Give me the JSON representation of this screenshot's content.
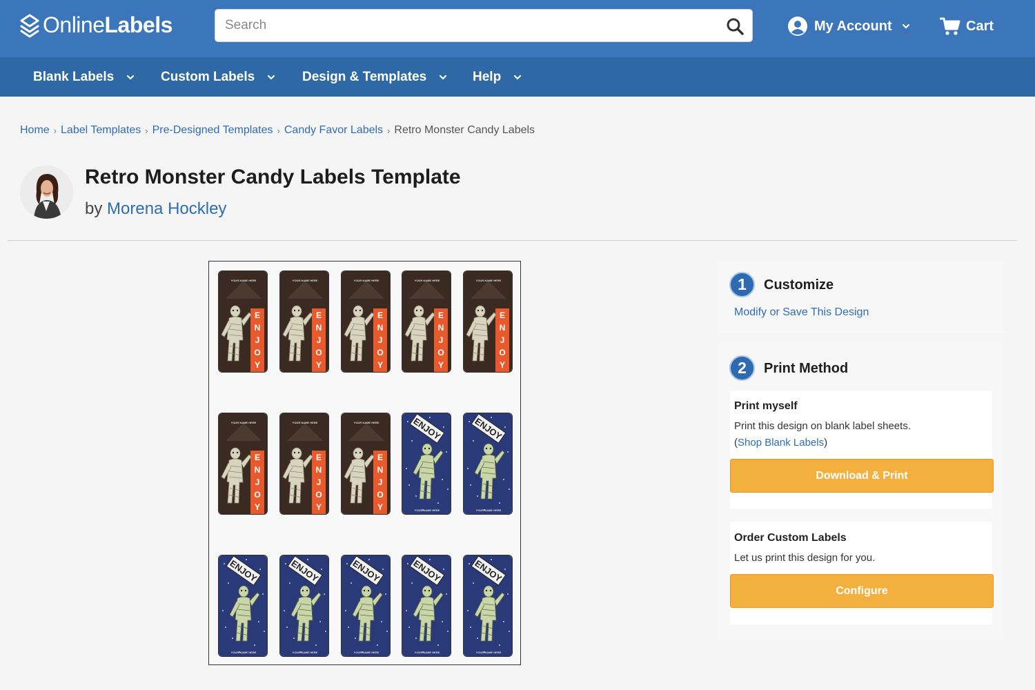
{
  "header": {
    "logo_text_light": "Online",
    "logo_text_bold": "Labels",
    "search_placeholder": "Search",
    "account_label": "My Account",
    "cart_label": "Cart",
    "brand_color": "#3a76b9",
    "nav_color": "#2e69a6"
  },
  "nav": {
    "items": [
      {
        "label": "Blank Labels"
      },
      {
        "label": "Custom Labels"
      },
      {
        "label": "Design & Templates"
      },
      {
        "label": "Help"
      }
    ]
  },
  "breadcrumb": {
    "items": [
      {
        "label": "Home"
      },
      {
        "label": "Label Templates"
      },
      {
        "label": "Pre-Designed Templates"
      },
      {
        "label": "Candy Favor Labels"
      }
    ],
    "current": "Retro Monster Candy Labels",
    "separator": "›"
  },
  "page": {
    "title": "Retro Monster Candy Labels Template",
    "by_prefix": "by",
    "author": "Morena Hockley"
  },
  "sheet": {
    "label_orange_text": "ENJOY",
    "label_top_text": "YOUR NAME HERE",
    "label_bottom_text": "YOUR NAME HERE",
    "rows": [
      [
        "mummy-brown",
        "mummy-brown",
        "mummy-brown",
        "mummy-brown",
        "mummy-brown"
      ],
      [
        "mummy-brown",
        "mummy-brown",
        "mummy-brown",
        "mummy-blue",
        "mummy-blue"
      ],
      [
        "mummy-blue",
        "mummy-blue",
        "mummy-blue",
        "mummy-blue",
        "mummy-blue"
      ]
    ]
  },
  "customize": {
    "step": "1",
    "title": "Customize",
    "link": "Modify or Save This Design"
  },
  "print_method": {
    "step": "2",
    "title": "Print Method",
    "print_myself": {
      "title": "Print myself",
      "text": "Print this design on blank label sheets.",
      "link_open": "(",
      "link": "Shop Blank Labels",
      "link_close": ")",
      "button": "Download & Print"
    },
    "order_custom": {
      "title": "Order Custom Labels",
      "text": "Let us print this design for you.",
      "button": "Configure"
    },
    "button_color": "#f3b03f"
  }
}
